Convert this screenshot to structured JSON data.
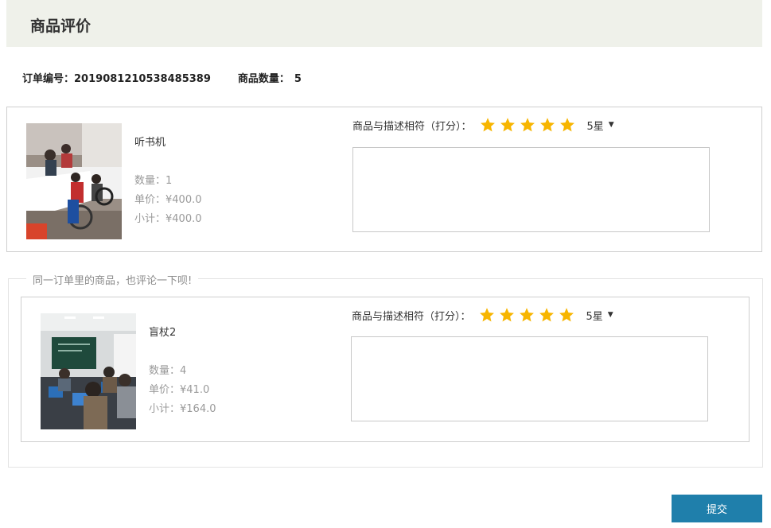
{
  "page": {
    "title": "商品评价"
  },
  "order": {
    "number_label": "订单编号：",
    "number_value": "2019081210538485389",
    "count_label": "商品数量：",
    "count_value": "5"
  },
  "items": [
    {
      "name": "听书机",
      "qty": "数量：1",
      "price": "单价：¥400.0",
      "subtotal": "小计：¥400.0",
      "rating_label": "商品与描述相符（打分）：",
      "stars": 5,
      "rating_value": "5星",
      "thumb_icon": "classroom-photo-icon"
    },
    {
      "name": "盲杖2",
      "qty": "数量：4",
      "price": "单价：¥41.0",
      "subtotal": "小计：¥164.0",
      "rating_label": "商品与描述相符（打分）：",
      "stars": 5,
      "rating_value": "5星",
      "thumb_icon": "computer-lab-photo-icon"
    }
  ],
  "same_order_prompt": "同一订单里的商品，也评论一下呗!",
  "submit_label": "提交",
  "colors": {
    "star": "#f7b500",
    "header_bg": "#eff1ea",
    "submit_bg": "#1f7fab"
  }
}
